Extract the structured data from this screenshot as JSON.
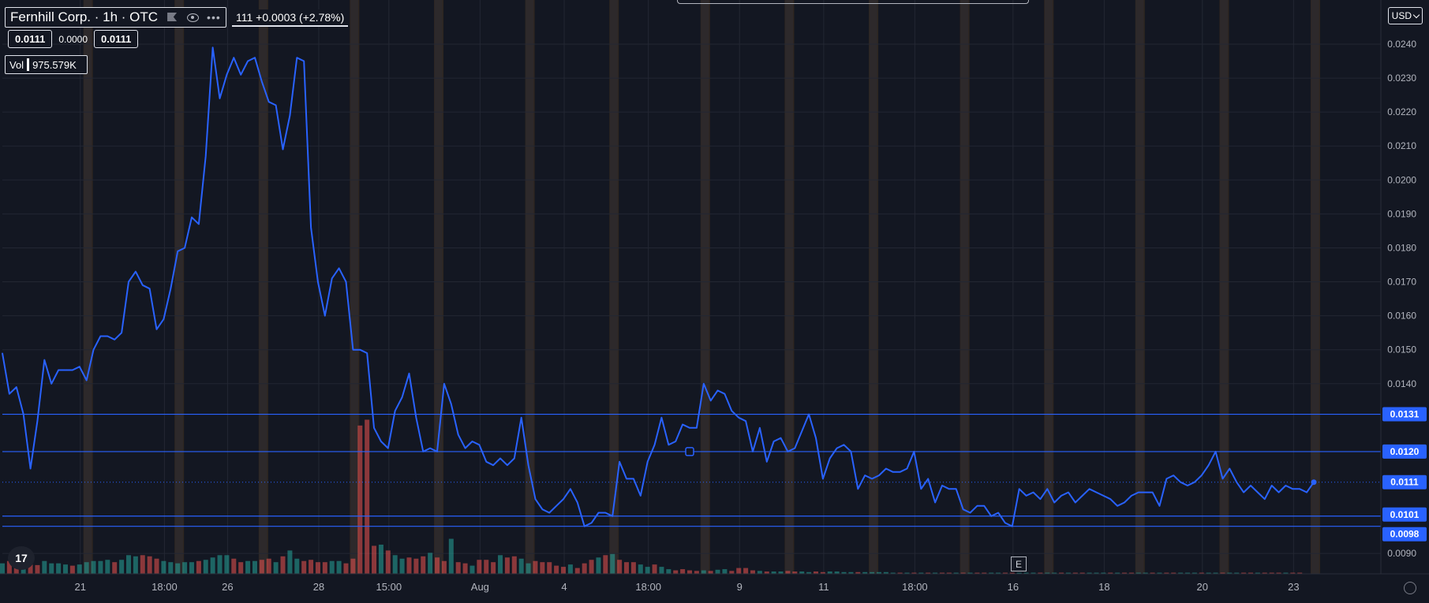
{
  "header": {
    "symbol_title": "Fernhill Corp. · 1h · OTC",
    "change_text": "111 +0.0003 (+2.78%)",
    "chips": [
      "0.0111",
      "0.0000",
      "0.0111"
    ],
    "volume_label": "Vol",
    "volume_value": "975.579K",
    "currency": "USD",
    "logo_text": "17",
    "earnings_marker": "E",
    "icons": [
      "flag-icon",
      "eye-icon",
      "more-dots-icon",
      "settings-icon",
      "chevron-down-icon"
    ]
  },
  "colors": {
    "background": "#131722",
    "line": "#2962ff",
    "volume_up": "#26a69a",
    "volume_down": "#ef5350",
    "session_band": "#f7931a",
    "hline": "#2962ff",
    "label_fill": "#2962ff",
    "axis_text": "#b2b5be"
  },
  "chart_data": {
    "type": "line",
    "title": "Fernhill Corp. · 1h · OTC",
    "ylim": [
      0.0084,
      0.0253
    ],
    "grid": true,
    "y_ticks": [
      "0.0090",
      "0.0140",
      "0.0150",
      "0.0160",
      "0.0170",
      "0.0180",
      "0.0190",
      "0.0200",
      "0.0210",
      "0.0220",
      "0.0230",
      "0.0240"
    ],
    "x_ticks": [
      "21",
      "18:00",
      "26",
      "28",
      "15:00",
      "Aug",
      "4",
      "18:00",
      "9",
      "11",
      "18:00",
      "16",
      "18",
      "20",
      "23"
    ],
    "series": [
      {
        "values": [
          0.0149,
          0.0137,
          0.0139,
          0.0131,
          0.0115,
          0.0129,
          0.0147,
          0.014,
          0.0144,
          0.0144,
          0.0144,
          0.0145,
          0.0141,
          0.015,
          0.0154,
          0.0154,
          0.0153,
          0.0155,
          0.017,
          0.0173,
          0.0169,
          0.0168,
          0.0156,
          0.0159,
          0.0168,
          0.0179,
          0.018,
          0.0189,
          0.0187,
          0.0207,
          0.0239,
          0.0224,
          0.0231,
          0.0236,
          0.0231,
          0.0235,
          0.0236,
          0.0229,
          0.0223,
          0.0222,
          0.0209,
          0.0219,
          0.0236,
          0.0235,
          0.0186,
          0.017,
          0.016,
          0.0171,
          0.0174,
          0.017,
          0.015,
          0.015,
          0.0149,
          0.0127,
          0.0123,
          0.0121,
          0.0132,
          0.0136,
          0.0143,
          0.013,
          0.012,
          0.0121,
          0.012,
          0.014,
          0.0134,
          0.0125,
          0.0121,
          0.0123,
          0.0122,
          0.0117,
          0.0116,
          0.0118,
          0.0116,
          0.0118,
          0.013,
          0.0116,
          0.0106,
          0.0103,
          0.0102,
          0.0104,
          0.0106,
          0.0109,
          0.0105,
          0.0098,
          0.0099,
          0.0102,
          0.0102,
          0.0101,
          0.0117,
          0.0112,
          0.0112,
          0.0107,
          0.0117,
          0.0122,
          0.013,
          0.0122,
          0.0123,
          0.0128,
          0.0127,
          0.0127,
          0.014,
          0.0135,
          0.0138,
          0.0137,
          0.0132,
          0.013,
          0.0129,
          0.012,
          0.0127,
          0.0117,
          0.0123,
          0.0124,
          0.012,
          0.0121,
          0.0126,
          0.0131,
          0.0124,
          0.0112,
          0.0118,
          0.0121,
          0.0122,
          0.012,
          0.0109,
          0.0113,
          0.0112,
          0.0113,
          0.0115,
          0.0114,
          0.0114,
          0.0115,
          0.012,
          0.0109,
          0.0112,
          0.0105,
          0.011,
          0.0109,
          0.0109,
          0.0103,
          0.0102,
          0.0104,
          0.0104,
          0.0101,
          0.0102,
          0.0099,
          0.0098,
          0.0109,
          0.0107,
          0.0108,
          0.0106,
          0.0109,
          0.0105,
          0.0107,
          0.0108,
          0.0105,
          0.0107,
          0.0109,
          0.0108,
          0.0107,
          0.0106,
          0.0104,
          0.0105,
          0.0107,
          0.0108,
          0.0108,
          0.0108,
          0.0104,
          0.0112,
          0.0113,
          0.0111,
          0.011,
          0.0111,
          0.0113,
          0.0116,
          0.012,
          0.0112,
          0.0115,
          0.0111,
          0.0108,
          0.011,
          0.0108,
          0.0106,
          0.011,
          0.0108,
          0.011,
          0.0109,
          0.0109,
          0.0108,
          0.0111
        ]
      }
    ],
    "volume": {
      "ylim": [
        0,
        1
      ],
      "values": [
        0.18,
        0.22,
        0.24,
        0.2,
        0.16,
        0.15,
        0.22,
        0.18,
        0.18,
        0.16,
        0.14,
        0.16,
        0.2,
        0.22,
        0.22,
        0.24,
        0.2,
        0.24,
        0.32,
        0.3,
        0.32,
        0.3,
        0.26,
        0.22,
        0.2,
        0.18,
        0.2,
        0.2,
        0.22,
        0.24,
        0.28,
        0.32,
        0.32,
        0.26,
        0.2,
        0.22,
        0.22,
        0.24,
        0.26,
        0.2,
        0.3,
        0.4,
        0.26,
        0.22,
        0.24,
        0.2,
        0.2,
        0.22,
        0.22,
        0.18,
        0.26,
        2.54,
        2.64,
        0.48,
        0.5,
        0.4,
        0.32,
        0.26,
        0.28,
        0.26,
        0.3,
        0.36,
        0.28,
        0.22,
        0.6,
        0.2,
        0.18,
        0.14,
        0.24,
        0.24,
        0.2,
        0.32,
        0.28,
        0.3,
        0.26,
        0.18,
        0.22,
        0.2,
        0.2,
        0.14,
        0.12,
        0.16,
        0.1,
        0.18,
        0.24,
        0.28,
        0.32,
        0.34,
        0.24,
        0.2,
        0.2,
        0.16,
        0.12,
        0.16,
        0.12,
        0.08,
        0.06,
        0.08,
        0.06,
        0.05,
        0.06,
        0.05,
        0.07,
        0.08,
        0.05,
        0.1,
        0.1,
        0.06,
        0.05,
        0.04,
        0.04,
        0.04,
        0.05,
        0.04,
        0.04,
        0.03,
        0.04,
        0.03,
        0.04,
        0.04,
        0.03,
        0.03,
        0.03,
        0.03,
        0.03,
        0.03,
        0.03,
        0.02,
        0.02,
        0.02,
        0.02,
        0.02,
        0.02,
        0.02,
        0.02,
        0.02,
        0.02,
        0.02,
        0.02,
        0.02,
        0.02,
        0.02,
        0.02,
        0.02,
        0.02,
        0.02,
        0.02,
        0.02,
        0.02,
        0.02,
        0.02,
        0.02,
        0.02,
        0.02,
        0.02,
        0.02,
        0.02,
        0.02,
        0.02,
        0.02,
        0.02,
        0.02,
        0.02,
        0.02,
        0.02,
        0.02,
        0.02,
        0.02,
        0.02,
        0.02,
        0.02,
        0.02,
        0.02,
        0.02,
        0.02,
        0.02,
        0.02,
        0.02,
        0.02,
        0.02,
        0.02,
        0.02,
        0.02,
        0.02,
        0.02,
        0.02
      ],
      "up": [
        true,
        false,
        false,
        true,
        false,
        false,
        true,
        true,
        true,
        true,
        false,
        true,
        true,
        true,
        true,
        true,
        false,
        true,
        true,
        true,
        false,
        false,
        false,
        true,
        true,
        true,
        true,
        true,
        false,
        true,
        true,
        true,
        true,
        false,
        false,
        true,
        true,
        false,
        false,
        true,
        false,
        true,
        true,
        false,
        false,
        false,
        false,
        true,
        true,
        false,
        false,
        false,
        false,
        false,
        true,
        false,
        true,
        true,
        false,
        false,
        false,
        true,
        false,
        false,
        true,
        false,
        false,
        true,
        false,
        false,
        false,
        true,
        false,
        false,
        true,
        true,
        false,
        false,
        false,
        false,
        false,
        true,
        false,
        false,
        false,
        true,
        false,
        true,
        false,
        false,
        false,
        true,
        true,
        false,
        true,
        true,
        false,
        false,
        false,
        false,
        true,
        false,
        true,
        true,
        false,
        false,
        false,
        false,
        true,
        false,
        true,
        true,
        false,
        false,
        true,
        true,
        false,
        false,
        true,
        true,
        true,
        true,
        false,
        true,
        true,
        true,
        true,
        true,
        false,
        true,
        false,
        true,
        false,
        true,
        false,
        false,
        true,
        false,
        true,
        false,
        false,
        true,
        true,
        false,
        false,
        true,
        true,
        true,
        false,
        true,
        true,
        false,
        true,
        false,
        false,
        true,
        true,
        true,
        false,
        true,
        false,
        false,
        true,
        true,
        false,
        true,
        false,
        false,
        true,
        true,
        true,
        false,
        true,
        true,
        false,
        true,
        true,
        false,
        false,
        true,
        false,
        false,
        false,
        true,
        false,
        false,
        true,
        false,
        true,
        false
      ]
    },
    "session_bands": [
      12,
      25,
      37,
      50,
      62,
      75,
      87,
      100,
      112,
      124,
      137,
      149,
      162,
      174,
      187,
      200
    ],
    "horizontal_lines": [
      {
        "value": 0.0131,
        "label": "0.0131"
      },
      {
        "value": 0.012,
        "label": "0.0120"
      },
      {
        "value": 0.0101,
        "label": "0.0101"
      },
      {
        "value": 0.0098,
        "label": "0.0098"
      }
    ],
    "last_price": {
      "value": 0.0111,
      "label": "0.0111"
    },
    "marker_index": 98
  }
}
